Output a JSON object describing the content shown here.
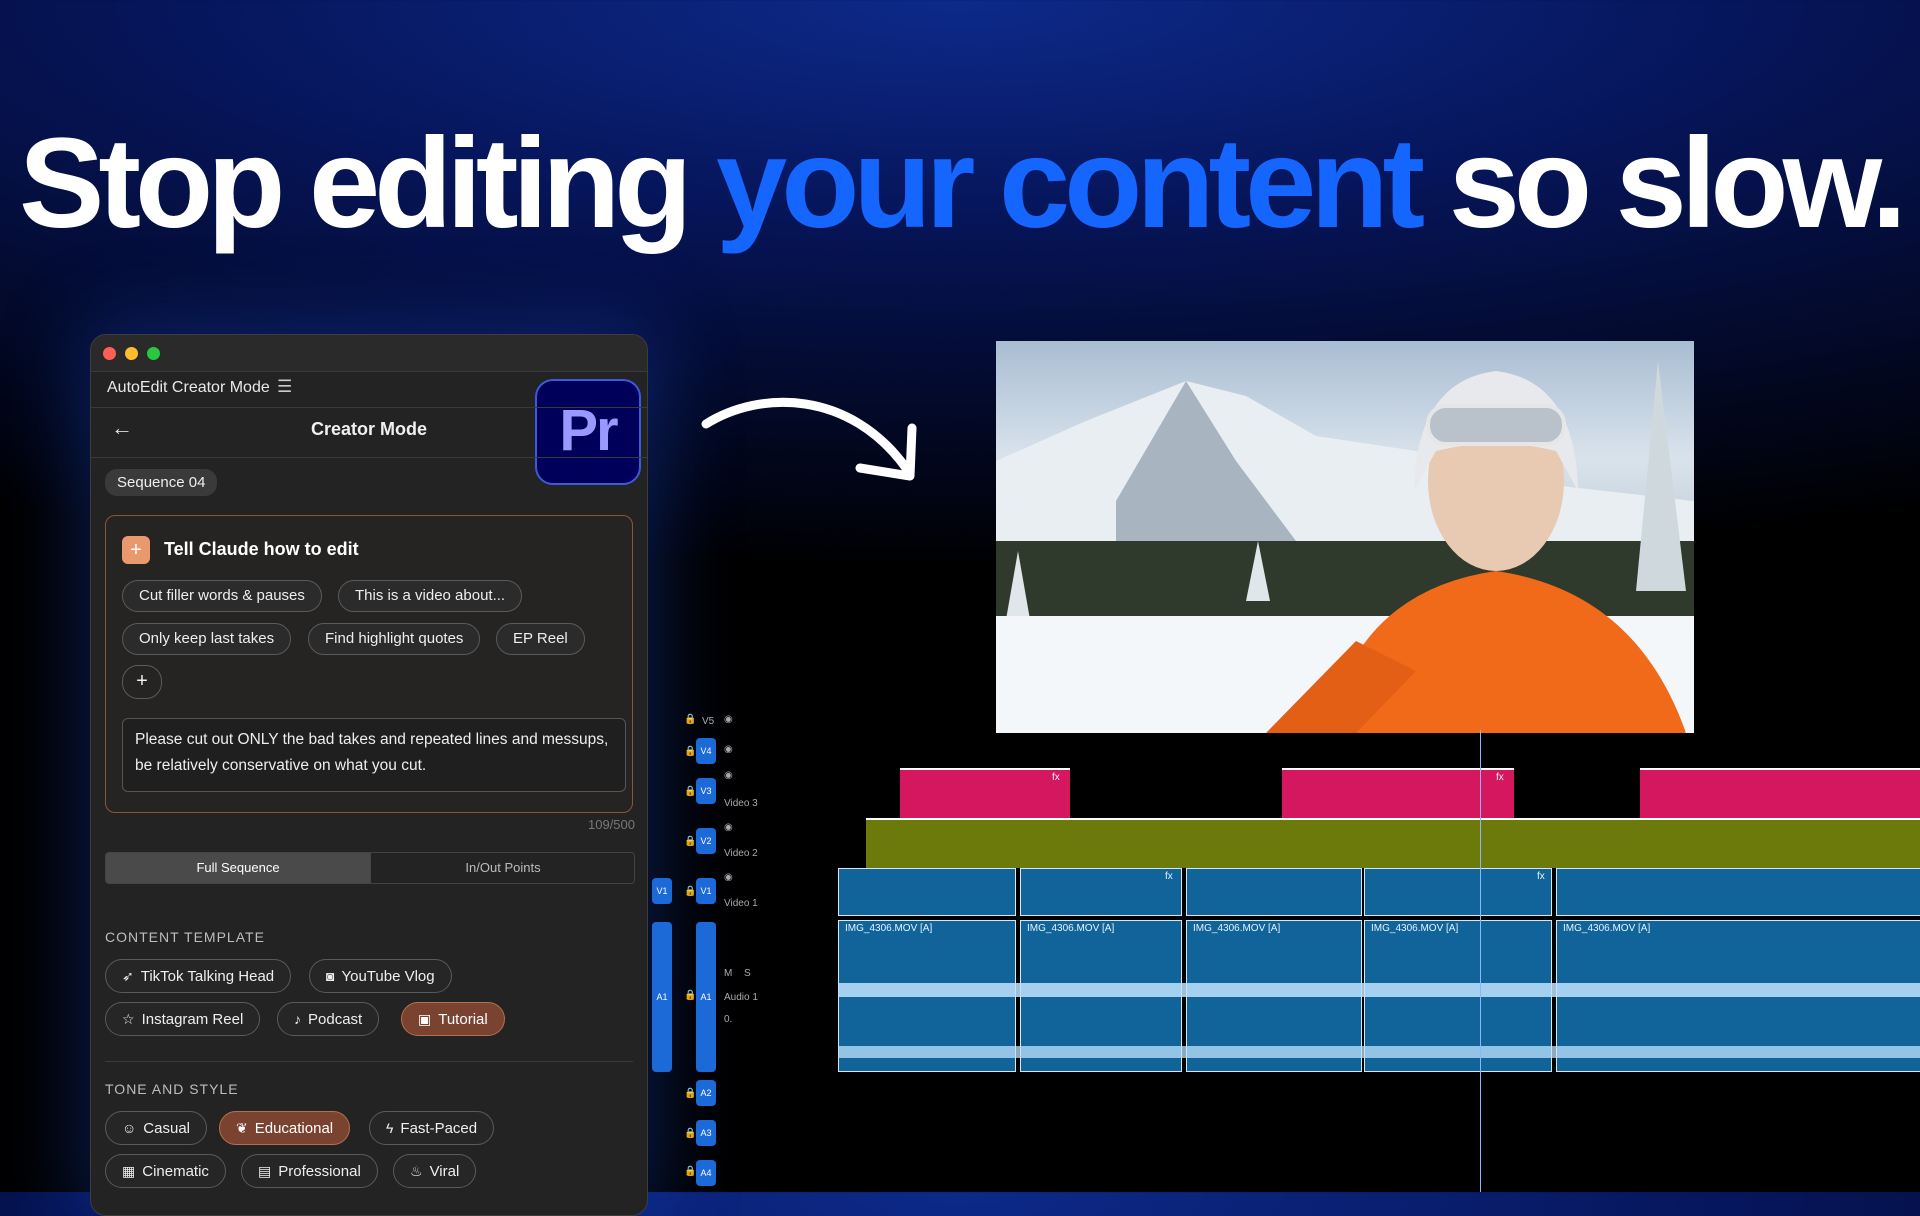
{
  "headline": {
    "part1": "Stop editing ",
    "highlight": "your content",
    "part2": " so slow."
  },
  "panel": {
    "app_name": "AutoEdit Creator Mode",
    "header_title": "Creator Mode",
    "logo_text": "Pr",
    "sequence": "Sequence 04",
    "claude_title": "Tell Claude how to edit",
    "quick_chips": [
      "Cut filler words & pauses",
      "This is a video about...",
      "Only keep last takes",
      "Find highlight quotes",
      "EP Reel"
    ],
    "add_label": "+",
    "prompt_text": "Please cut out ONLY the bad takes and repeated lines and messups, be relatively conservative on what you cut.",
    "counter": "109/500",
    "range_tabs": [
      "Full Sequence",
      "In/Out Points"
    ],
    "content_template_label": "CONTENT TEMPLATE",
    "content_templates": [
      {
        "label": "TikTok Talking Head",
        "icon": "rocket-icon",
        "active": false
      },
      {
        "label": "YouTube Vlog",
        "icon": "camera-icon",
        "active": false
      },
      {
        "label": "Instagram Reel",
        "icon": "star-icon",
        "active": false
      },
      {
        "label": "Podcast",
        "icon": "mic-icon",
        "active": false
      },
      {
        "label": "Tutorial",
        "icon": "book-icon",
        "active": true
      }
    ],
    "tone_label": "TONE AND STYLE",
    "tones": [
      {
        "label": "Casual",
        "icon": "smile-icon",
        "active": false
      },
      {
        "label": "Educational",
        "icon": "leaf-icon",
        "active": true
      },
      {
        "label": "Fast-Paced",
        "icon": "bolt-icon",
        "active": false
      },
      {
        "label": "Cinematic",
        "icon": "film-icon",
        "active": false
      },
      {
        "label": "Professional",
        "icon": "briefcase-icon",
        "active": false
      },
      {
        "label": "Viral",
        "icon": "flame-icon",
        "active": false
      }
    ]
  },
  "timeline": {
    "tracks": {
      "v5": "V5",
      "v4": "V4",
      "v3": "V3",
      "v2": "V2",
      "v1": "V1",
      "a1": "A1",
      "a2": "A2",
      "a3": "A3",
      "a4": "A4",
      "video3": "Video 3",
      "video2": "Video 2",
      "video1": "Video 1",
      "audio1": "Audio 1"
    },
    "clip_name": "IMG_4306.MOV [A]",
    "fx": "fx",
    "m": "M",
    "s": "S",
    "level": "0."
  },
  "colors": {
    "accent_blue": "#1565ff",
    "track_pink": "#d4175f",
    "track_olive": "#6b7a0a",
    "track_blue": "#10649a",
    "active_pill": "#7a4330"
  }
}
